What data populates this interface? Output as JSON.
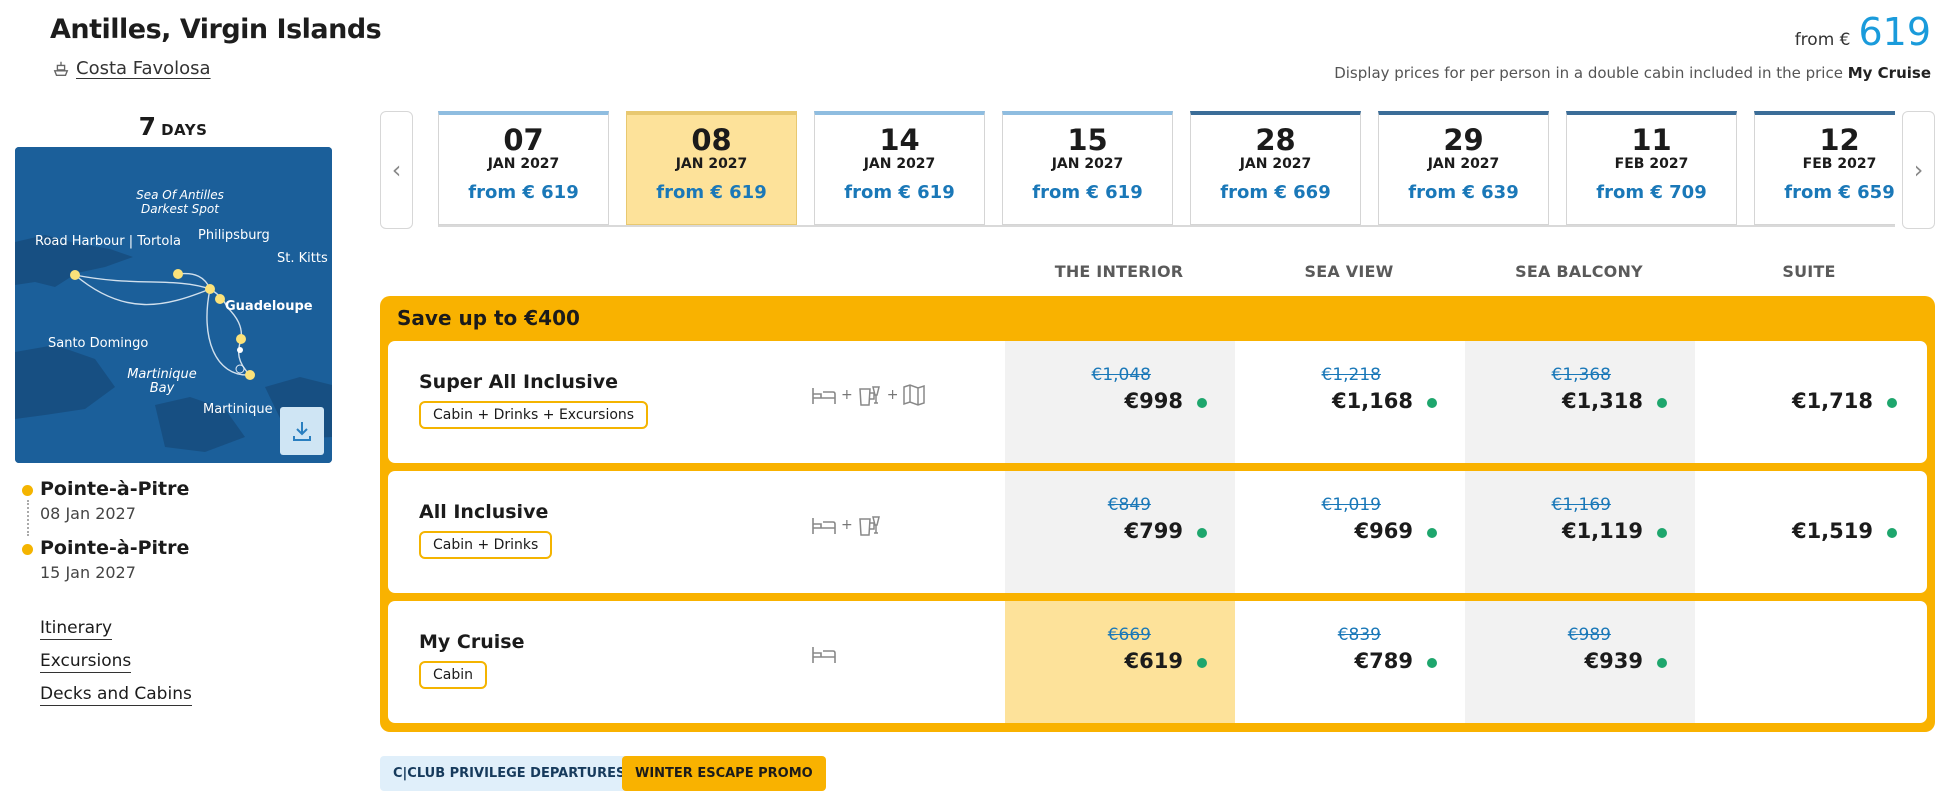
{
  "header": {
    "title": "Antilles, Virgin Islands",
    "ship": "Costa Favolosa",
    "from_prefix": "from €",
    "from_value": "619",
    "note_text": "Display prices for per person in a double cabin included in the price",
    "note_bold": "My Cruise"
  },
  "duration": {
    "number": "7",
    "unit": "DAYS"
  },
  "map": {
    "labels": [
      "Sea Of Antilles",
      "Darkest Spot",
      "Road Harbour | Tortola",
      "Philipsburg",
      "St. Kitts",
      "Guadeloupe",
      "Santo Domingo",
      "Martinique",
      "Bay",
      "Martinique"
    ]
  },
  "route": {
    "stops": [
      {
        "port": "Pointe-à-Pitre",
        "date": "08 Jan 2027"
      },
      {
        "port": "Pointe-à-Pitre",
        "date": "15 Jan 2027"
      }
    ]
  },
  "links": [
    "Itinerary",
    "Excursions",
    "Decks and Cabins"
  ],
  "dates": [
    {
      "day": "07",
      "month": "JAN 2027",
      "price": "from € 619"
    },
    {
      "day": "08",
      "month": "JAN 2027",
      "price": "from € 619"
    },
    {
      "day": "14",
      "month": "JAN 2027",
      "price": "from € 619"
    },
    {
      "day": "15",
      "month": "JAN 2027",
      "price": "from € 619"
    },
    {
      "day": "28",
      "month": "JAN 2027",
      "price": "from € 669"
    },
    {
      "day": "29",
      "month": "JAN 2027",
      "price": "from € 639"
    },
    {
      "day": "11",
      "month": "FEB 2027",
      "price": "from € 709"
    },
    {
      "day": "12",
      "month": "FEB 2027",
      "price": "from € 659"
    }
  ],
  "columns": [
    "THE INTERIOR",
    "SEA VIEW",
    "SEA BALCONY",
    "SUITE"
  ],
  "promo": {
    "title": "Save up to €400"
  },
  "fares": [
    {
      "name": "Super All Inclusive",
      "tag": "Cabin + Drinks + Excursions",
      "icons": [
        "bed-icon",
        "drinks-icon",
        "map-icon"
      ],
      "prices": [
        {
          "old": "€1,048",
          "new": "€998"
        },
        {
          "old": "€1,218",
          "new": "€1,168"
        },
        {
          "old": "€1,368",
          "new": "€1,318"
        },
        {
          "old": "",
          "new": "€1,718"
        }
      ]
    },
    {
      "name": "All Inclusive",
      "tag": "Cabin + Drinks",
      "icons": [
        "bed-icon",
        "drinks-icon"
      ],
      "prices": [
        {
          "old": "€849",
          "new": "€799"
        },
        {
          "old": "€1,019",
          "new": "€969"
        },
        {
          "old": "€1,169",
          "new": "€1,119"
        },
        {
          "old": "",
          "new": "€1,519"
        }
      ]
    },
    {
      "name": "My Cruise",
      "tag": "Cabin",
      "icons": [
        "bed-icon"
      ],
      "prices": [
        {
          "old": "€669",
          "new": "€619"
        },
        {
          "old": "€839",
          "new": "€789"
        },
        {
          "old": "€989",
          "new": "€939"
        },
        {
          "old": "",
          "new": ""
        }
      ]
    }
  ],
  "badges": [
    "C|CLUB PRIVILEGE DEPARTURES",
    "WINTER ESCAPE PROMO"
  ],
  "colors": {
    "accent": "#f9b200",
    "brand_blue": "#1a9bdb",
    "available": "#1ea66d"
  }
}
